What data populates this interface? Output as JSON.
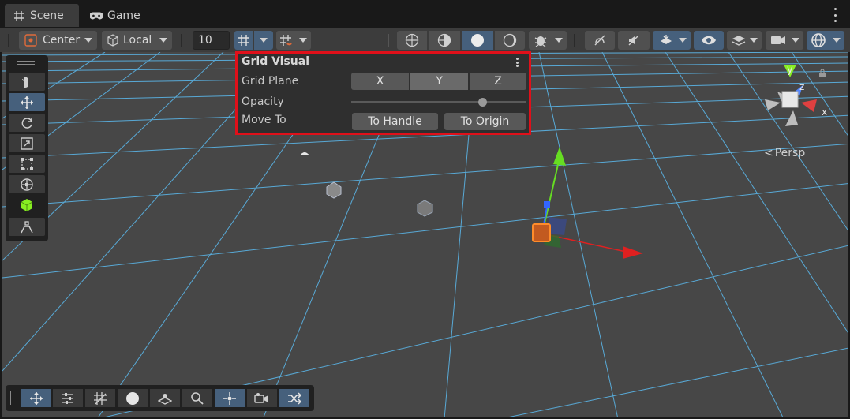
{
  "tabs": [
    {
      "label": "Scene",
      "icon": "hash-icon",
      "active": true
    },
    {
      "label": "Game",
      "icon": "gamepad-icon",
      "active": false
    }
  ],
  "toolbar": {
    "pivot_label": "Center",
    "space_label": "Local",
    "grid_size": "10"
  },
  "grid_visual": {
    "title": "Grid Visual",
    "grid_plane_label": "Grid Plane",
    "planes": [
      "X",
      "Y",
      "Z"
    ],
    "selected_plane": "Y",
    "opacity_label": "Opacity",
    "opacity_value": 0.75,
    "move_to_label": "Move To",
    "to_handle_label": "To Handle",
    "to_origin_label": "To Origin"
  },
  "gizmo": {
    "y_label": "y",
    "z_label": "z",
    "x_label": "x",
    "projection_label": "Persp"
  },
  "colors": {
    "highlight": "#e0101a",
    "selected_button": "#46607c",
    "grid_line": "#5ab4e6",
    "x_axis": "#e02020",
    "y_axis": "#66dd22",
    "z_axis": "#3366ff"
  }
}
